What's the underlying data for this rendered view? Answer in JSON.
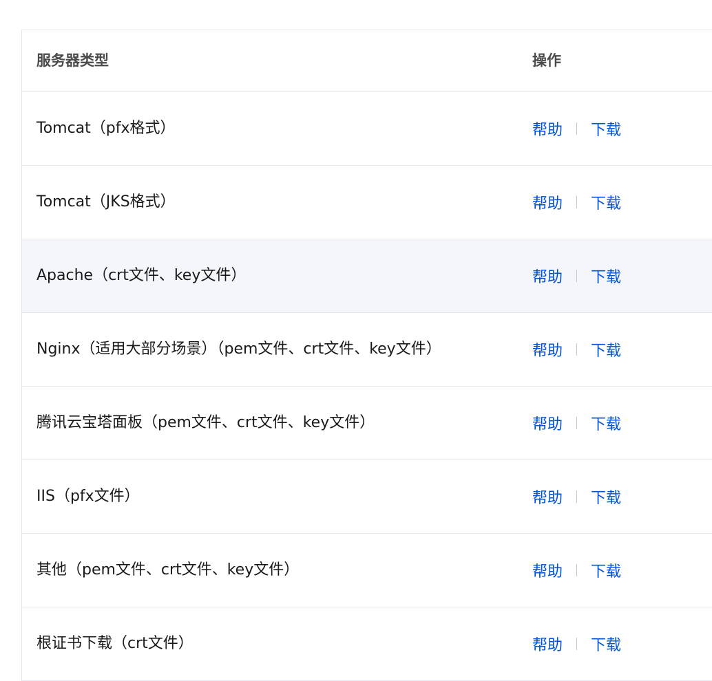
{
  "table": {
    "headers": {
      "server_type": "服务器类型",
      "action": "操作"
    },
    "rows": [
      {
        "type": "Tomcat（pfx格式）",
        "help": "帮助",
        "download": "下载"
      },
      {
        "type": "Tomcat（JKS格式）",
        "help": "帮助",
        "download": "下载"
      },
      {
        "type": "Apache（crt文件、key文件）",
        "help": "帮助",
        "download": "下载"
      },
      {
        "type": "Nginx（适用大部分场景）（pem文件、crt文件、key文件）",
        "help": "帮助",
        "download": "下载"
      },
      {
        "type": "腾讯云宝塔面板（pem文件、crt文件、key文件）",
        "help": "帮助",
        "download": "下载"
      },
      {
        "type": "IIS（pfx文件）",
        "help": "帮助",
        "download": "下载"
      },
      {
        "type": "其他（pem文件、crt文件、key文件）",
        "help": "帮助",
        "download": "下载"
      },
      {
        "type": "根证书下载（crt文件）",
        "help": "帮助",
        "download": "下载"
      }
    ],
    "hover_row_index": 2
  },
  "colors": {
    "link": "#0052d9",
    "hover_row_bg": "#f4f6fb",
    "border": "#e5e7eb"
  }
}
